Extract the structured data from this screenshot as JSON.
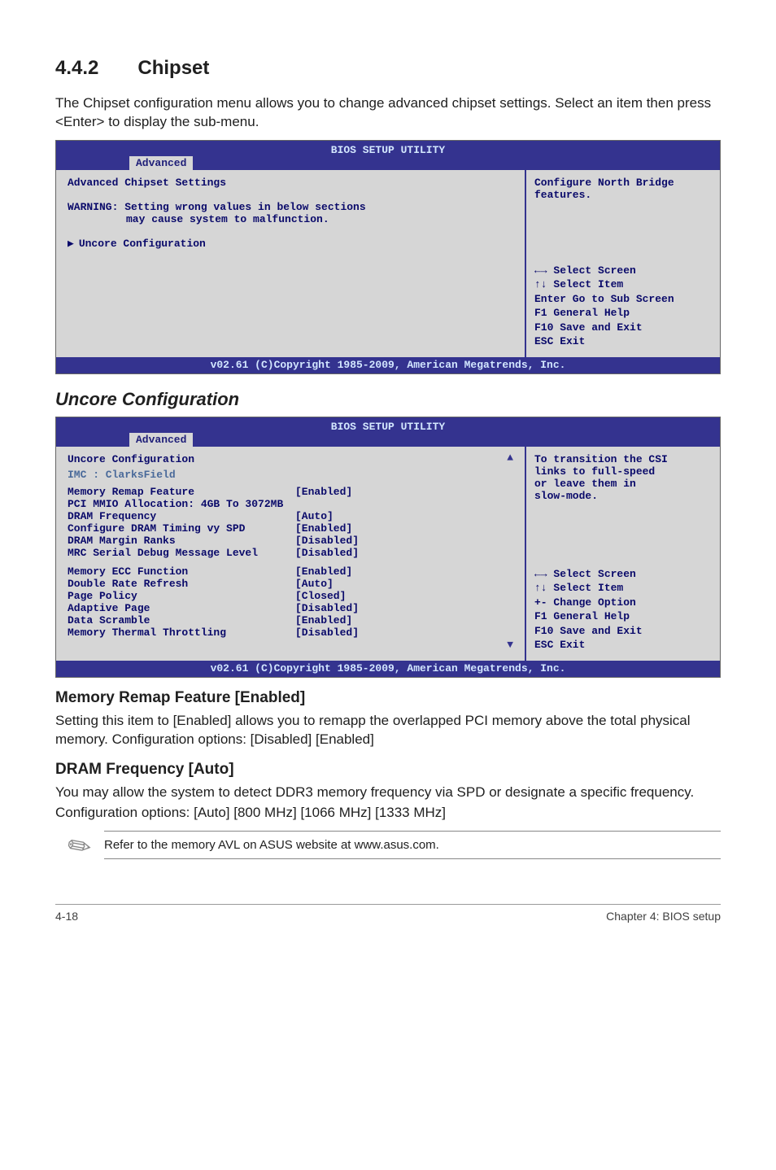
{
  "heading": {
    "number": "4.4.2",
    "title": "Chipset"
  },
  "intro": "The Chipset configuration menu allows you to change advanced chipset settings. Select an item then press <Enter> to display the sub-menu.",
  "bios1": {
    "util_title": "BIOS SETUP UTILITY",
    "tab": "Advanced",
    "left_title": "Advanced Chipset Settings",
    "warning_l1": "WARNING: Setting wrong values in below sections",
    "warning_l2": "may cause system to malfunction.",
    "item": "Uncore Configuration",
    "help": "Configure North Bridge features.",
    "nav1": "←→    Select Screen",
    "nav2": "↑↓    Select Item",
    "nav3": "Enter Go to Sub Screen",
    "nav4": "F1    General Help",
    "nav5": "F10   Save and Exit",
    "nav6": "ESC   Exit",
    "copyright": "v02.61 (C)Copyright 1985-2009, American Megatrends, Inc."
  },
  "uncore_heading": "Uncore Configuration",
  "bios2": {
    "util_title": "BIOS SETUP UTILITY",
    "tab": "Advanced",
    "left_title": "Uncore Configuration",
    "imc": "IMC : ClarksField",
    "rows": [
      {
        "lab": "Memory Remap Feature",
        "val": "[Enabled]"
      },
      {
        "lab": "  PCI MMIO Allocation: 4GB To 3072MB",
        "val": ""
      },
      {
        "lab": "DRAM Frequency",
        "val": "[Auto]"
      },
      {
        "lab": "Configure DRAM Timing vy SPD",
        "val": "[Enabled]"
      },
      {
        "lab": "DRAM Margin Ranks",
        "val": "[Disabled]"
      },
      {
        "lab": "MRC Serial Debug Message Level",
        "val": "[Disabled]"
      }
    ],
    "rows2": [
      {
        "lab": "Memory ECC Function",
        "val": "[Enabled]"
      },
      {
        "lab": "Double Rate Refresh",
        "val": "[Auto]"
      },
      {
        "lab": "Page Policy",
        "val": "[Closed]"
      },
      {
        "lab": "Adaptive Page",
        "val": "[Disabled]"
      },
      {
        "lab": "Data Scramble",
        "val": "[Enabled]"
      },
      {
        "lab": "Memory Thermal Throttling",
        "val": "[Disabled]"
      }
    ],
    "help1": "To transition the CSI",
    "help2": "links to full-speed",
    "help3": "or leave them in",
    "help4": "slow-mode.",
    "nav1": "←→   Select Screen",
    "nav2": "↑↓   Select Item",
    "nav3": "+-   Change Option",
    "nav4": "F1   General Help",
    "nav5": "F10  Save and Exit",
    "nav6": "ESC  Exit",
    "copyright": "v02.61 (C)Copyright 1985-2009, American Megatrends, Inc."
  },
  "mrf_heading": "Memory Remap Feature [Enabled]",
  "mrf_text": "Setting this item to [Enabled] allows you to remapp the overlapped PCI memory above the total physical memory. Configuration options: [Disabled] [Enabled]",
  "dram_heading": "DRAM Frequency [Auto]",
  "dram_text1": "You may allow the system to detect DDR3 memory frequency via SPD or designate a specific frequency.",
  "dram_text2": "Configuration options: [Auto] [800 MHz] [1066 MHz] [1333 MHz]",
  "note": "Refer to the memory AVL on ASUS website at www.asus.com.",
  "footer_left": "4-18",
  "footer_right": "Chapter 4: BIOS setup"
}
